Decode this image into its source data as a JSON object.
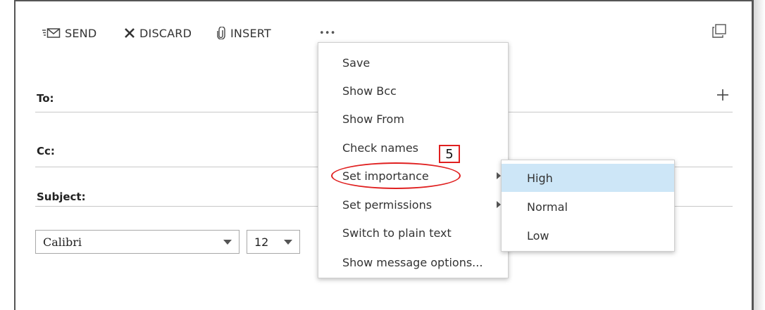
{
  "toolbar": {
    "send_label": "SEND",
    "discard_label": "DISCARD",
    "insert_label": "INSERT",
    "more_label": "•••"
  },
  "fields": {
    "to_label": "To:",
    "cc_label": "Cc:",
    "subject_label": "Subject:"
  },
  "formatting": {
    "font_value": "Calibri",
    "size_value": "12"
  },
  "more_menu": {
    "items": [
      {
        "label": "Save",
        "submenu": false
      },
      {
        "label": "Show Bcc",
        "submenu": false
      },
      {
        "label": "Show From",
        "submenu": false
      },
      {
        "label": "Check names",
        "submenu": false
      },
      {
        "label": "Set importance",
        "submenu": true
      },
      {
        "label": "Set permissions",
        "submenu": true
      },
      {
        "label": "Switch to plain text",
        "submenu": false
      },
      {
        "label": "Show message options...",
        "submenu": false
      }
    ]
  },
  "importance_submenu": {
    "items": [
      {
        "label": "High",
        "highlighted": true
      },
      {
        "label": "Normal",
        "highlighted": false
      },
      {
        "label": "Low",
        "highlighted": false
      }
    ]
  },
  "annotation": {
    "step_number": "5",
    "color": "#e02020"
  },
  "colors": {
    "highlight": "#cde6f7",
    "divider": "#c8c8c8"
  }
}
